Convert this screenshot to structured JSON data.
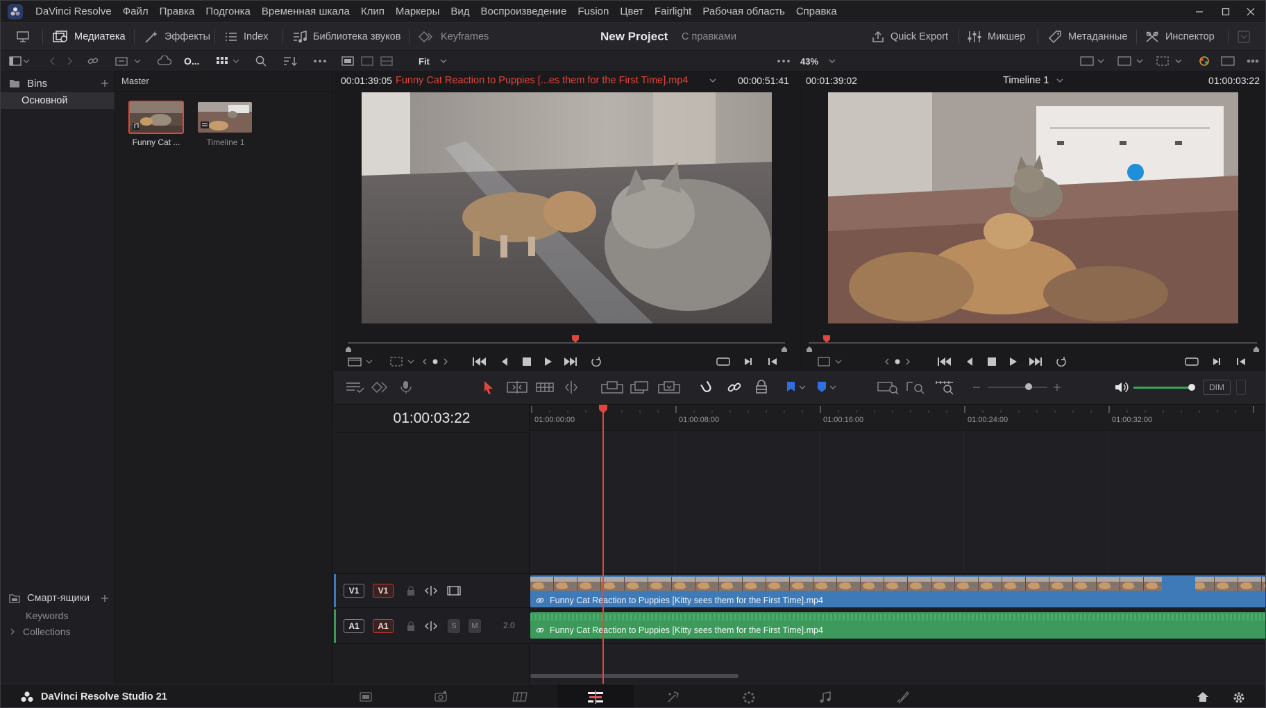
{
  "menubar": {
    "app_name": "DaVinci Resolve",
    "items": [
      "Файл",
      "Правка",
      "Подгонка",
      "Временная шкала",
      "Клип",
      "Маркеры",
      "Вид",
      "Воспроизведение",
      "Fusion",
      "Цвет",
      "Fairlight",
      "Рабочая область",
      "Справка"
    ]
  },
  "toolbar": {
    "media_pool": "Медиатека",
    "effects": "Эффекты",
    "index": "Index",
    "sound_library": "Библиотека звуков",
    "keyframes": "Keyframes",
    "project_title": "New Project",
    "project_status": "С правками",
    "quick_export": "Quick Export",
    "mixer": "Микшер",
    "metadata": "Метаданные",
    "inspector": "Инспектор"
  },
  "toolbar2": {
    "sort_label": "O...",
    "fit_label": "Fit",
    "zoom_label": "43%"
  },
  "bins": {
    "title": "Bins",
    "items": [
      "Основной"
    ],
    "smart_title": "Смарт-ящики",
    "smart_items": [
      "Keywords",
      "Collections"
    ]
  },
  "mediapool": {
    "breadcrumb": "Master",
    "clips": [
      "Funny Cat ...",
      "Timeline 1"
    ]
  },
  "source_viewer": {
    "timecode_left": "00:01:39:05",
    "clip_name": "Funny Cat Reaction to Puppies [...es them for the First Time].mp4",
    "duration": "00:00:51:41",
    "playhead_fraction": 0.52
  },
  "timeline_viewer": {
    "timecode_left": "00:01:39:02",
    "timeline_name": "Timeline 1",
    "timecode_right": "01:00:03:22",
    "playhead_fraction": 0.04
  },
  "edit_tools": {
    "dim_label": "DIM"
  },
  "timeline": {
    "current_timecode": "01:00:03:22",
    "ruler_labels": [
      "01:00:00:00",
      "01:00:08:00",
      "01:00:16:00",
      "01:00:24:00",
      "01:00:32:00"
    ],
    "video_track": {
      "dest": "V1",
      "src": "V1"
    },
    "audio_track": {
      "dest": "A1",
      "src": "A1",
      "solo": "S",
      "mute": "M",
      "channels": "2.0"
    },
    "video_clip_name": "Funny Cat Reaction to Puppies [Kitty sees them for the First Time].mp4",
    "audio_clip_name": "Funny Cat Reaction to Puppies [Kitty sees them for the First Time].mp4"
  },
  "pagebar": {
    "product": "DaVinci Resolve Studio 21"
  },
  "colors": {
    "accent_red": "#e0463c",
    "video_clip": "#3f7ab8",
    "audio_clip": "#3d9a5c",
    "active_page": "#d94a48"
  }
}
